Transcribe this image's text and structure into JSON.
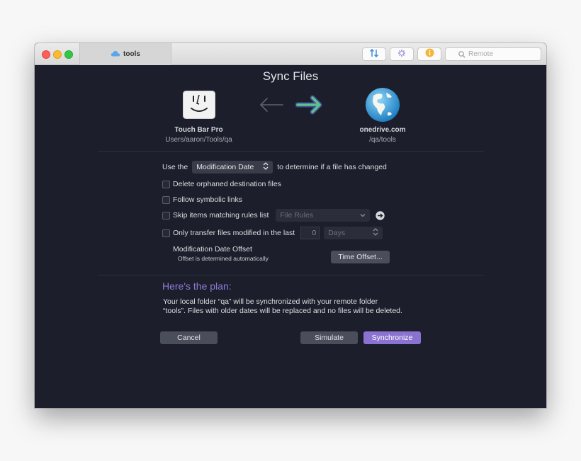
{
  "titlebar": {
    "tab_label": "tools",
    "search_placeholder": "Remote"
  },
  "sheet": {
    "title": "Sync Files",
    "source": {
      "name": "Touch Bar Pro",
      "path": "Users/aaron/Tools/qa",
      "icon": "finder-icon"
    },
    "destination": {
      "name": "onedrive.com",
      "path": "/qa/tools",
      "icon": "globe-icon"
    },
    "direction_icon": "arrow-right-icon"
  },
  "options": {
    "use_the": "Use the",
    "compare_method": "Modification Date",
    "compare_suffix": "to determine if a file has changed",
    "delete_orphaned": "Delete orphaned destination files",
    "follow_symlinks": "Follow symbolic links",
    "skip_rules": "Skip items matching rules list",
    "rules_select": "File Rules",
    "only_modified": "Only transfer files modified in the last",
    "days_value": "0",
    "days_unit": "Days",
    "offset_title": "Modification Date Offset",
    "offset_subtitle": "Offset is determined automatically",
    "time_offset_button": "Time Offset..."
  },
  "plan": {
    "heading": "Here's the plan:",
    "line1": "Your local folder “qa” will be synchronized with your remote folder",
    "line2": "“tools”. Files with older dates will be replaced and no files will be deleted."
  },
  "buttons": {
    "cancel": "Cancel",
    "simulate": "Simulate",
    "synchronize": "Synchronize"
  },
  "colors": {
    "background": "#1c1f2b",
    "accent": "#8a73d0",
    "arrow_active": "#58b79a"
  }
}
